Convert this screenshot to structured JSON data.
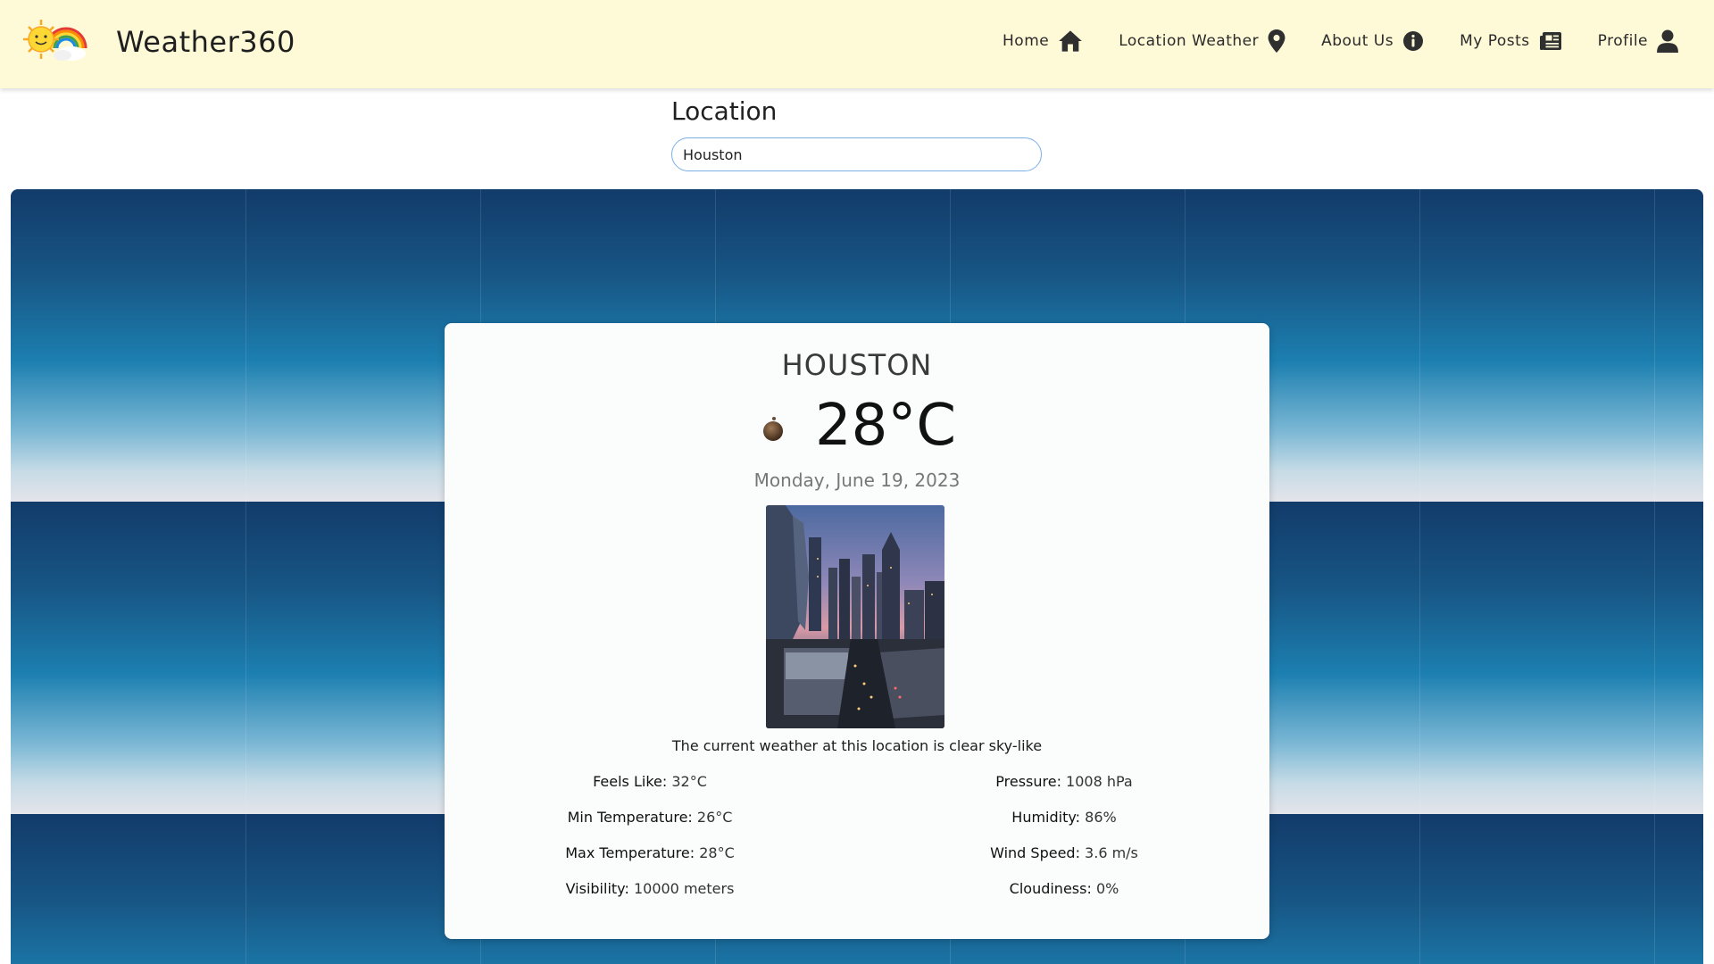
{
  "navbar": {
    "brand": "Weather360",
    "items": [
      {
        "label": "Home",
        "icon": "home-icon"
      },
      {
        "label": "Location Weather",
        "icon": "map-pin-icon"
      },
      {
        "label": "About Us",
        "icon": "info-icon"
      },
      {
        "label": "My Posts",
        "icon": "newspaper-icon"
      },
      {
        "label": "Profile",
        "icon": "user-icon"
      }
    ]
  },
  "location": {
    "label": "Location",
    "value": "Houston"
  },
  "weather": {
    "city": "HOUSTON",
    "temperature": "28°C",
    "date": "Monday, June 19, 2023",
    "description": "The current weather at this location is clear sky-like",
    "stats_left": [
      {
        "label": "Feels Like:",
        "value": "32°C"
      },
      {
        "label": "Min Temperature:",
        "value": "26°C"
      },
      {
        "label": "Max Temperature:",
        "value": "28°C"
      },
      {
        "label": "Visibility:",
        "value": "10000 meters"
      }
    ],
    "stats_right": [
      {
        "label": "Pressure:",
        "value": "1008 hPa"
      },
      {
        "label": "Humidity:",
        "value": "86%"
      },
      {
        "label": "Wind Speed:",
        "value": "3.6 m/s"
      },
      {
        "label": "Cloudiness:",
        "value": "0%"
      }
    ]
  },
  "colors": {
    "navbar_bg": "#fefad7",
    "input_border": "#7bb0e6",
    "sky_top": "#123b6a",
    "sky_bottom": "#e4e4ea"
  }
}
